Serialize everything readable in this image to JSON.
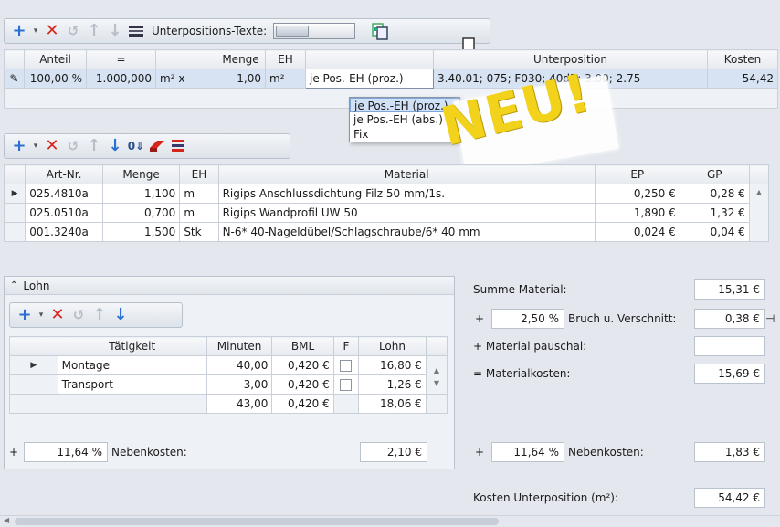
{
  "top_toolbar": {
    "buttons": [
      "add-icon",
      "dropdown-caret",
      "delete-icon",
      "undo-icon",
      "move-up-icon",
      "move-down-icon",
      "text-block-icon"
    ],
    "toggle_label": "Unterpositions-Texte:"
  },
  "unterposition_grid": {
    "columns": [
      "Anteil",
      "=",
      "",
      "Menge",
      "EH",
      "",
      "Unterposition",
      "Kosten"
    ],
    "row": {
      "anteil": "100,00 %",
      "factor": "1.000,000",
      "unit": "m² x",
      "menge": "1,00",
      "eh": "m²",
      "mode": "je Pos.-EH (proz.)",
      "unterposition": "3.40.01; 075; F030; 40dB; 3.00; 2.75",
      "kosten": "54,42"
    }
  },
  "mode_dropdown": {
    "options": [
      "je Pos.-EH (proz.)",
      "je Pos.-EH (abs.)",
      "Fix"
    ],
    "selected_index": 0
  },
  "stamp": {
    "text": "NEU!"
  },
  "material_toolbar": {
    "buttons": [
      "add-icon",
      "dropdown-caret",
      "delete-icon",
      "undo-icon",
      "move-up-icon",
      "move-down-icon",
      "import-icon",
      "eraser-icon",
      "list-icon"
    ]
  },
  "material_grid": {
    "columns": [
      "Art-Nr.",
      "Menge",
      "EH",
      "Material",
      "EP",
      "GP"
    ],
    "rows": [
      {
        "art": "025.4810a",
        "menge": "1,100",
        "eh": "m",
        "material": "Rigips Anschlussdichtung Filz  50 mm/1s.",
        "ep": "0,250 €",
        "gp": "0,28 €"
      },
      {
        "art": "025.0510a",
        "menge": "0,700",
        "eh": "m",
        "material": "Rigips Wandprofil UW  50",
        "ep": "1,890 €",
        "gp": "1,32 €"
      },
      {
        "art": "001.3240a",
        "menge": "1,500",
        "eh": "Stk",
        "material": "N-6* 40-Nageldübel/Schlagschraube/6* 40 mm",
        "ep": "0,024 €",
        "gp": "0,04 €"
      }
    ]
  },
  "lohn_panel": {
    "title": "Lohn",
    "columns": [
      "Tätigkeit",
      "Minuten",
      "BML",
      "F",
      "Lohn"
    ],
    "rows": [
      {
        "taetigkeit": "Montage",
        "minuten": "40,00",
        "bml": "0,420 €",
        "lohn": "16,80 €"
      },
      {
        "taetigkeit": "Transport",
        "minuten": "3,00",
        "bml": "0,420 €",
        "lohn": "1,26 €"
      }
    ],
    "totals": {
      "minuten": "43,00",
      "bml": "0,420 €",
      "lohn": "18,06 €"
    },
    "nebenkosten": {
      "sign": "+",
      "percent": "11,64 %",
      "label": "Nebenkosten:",
      "value": "2,10 €"
    }
  },
  "summary": {
    "summe_material_label": "Summe Material:",
    "summe_material": "15,31 €",
    "bruch_sign": "+",
    "bruch_percent": "2,50 %",
    "bruch_label": "Bruch u. Verschnitt:",
    "bruch_value": "0,38 €",
    "pauschal_label": "+ Material pauschal:",
    "pauschal_value": "",
    "materialkosten_label": "= Materialkosten:",
    "materialkosten": "15,69 €",
    "nk_sign": "+",
    "nk_percent": "11,64 %",
    "nk_label": "Nebenkosten:",
    "nk_value": "1,83 €",
    "kosten_label": "Kosten Unterposition (m²):",
    "kosten_value": "54,42 €"
  },
  "colors": {
    "accent_blue": "#2b6fd1",
    "delete_red": "#d4261c",
    "stamp_yellow": "#f2d21b",
    "selection": "#d7e3f3"
  }
}
